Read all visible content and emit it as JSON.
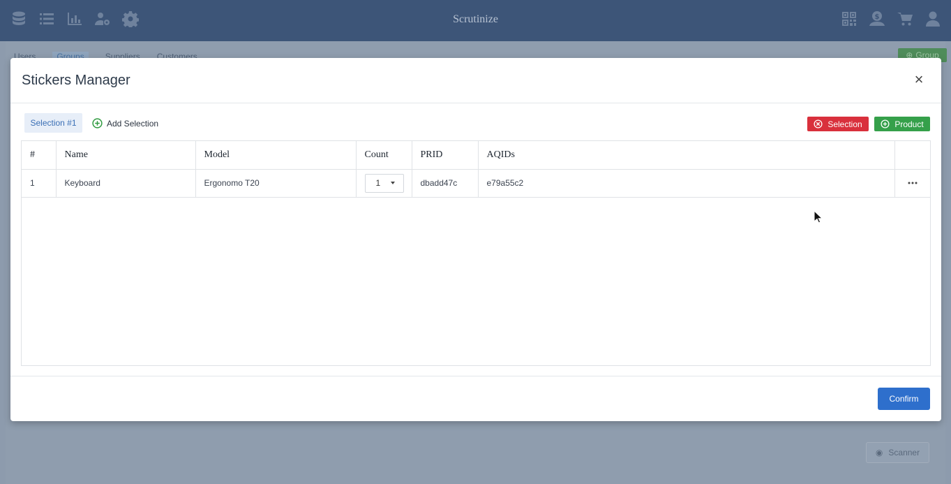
{
  "app": {
    "title": "Scrutinize",
    "nav_icons": [
      "database-icon",
      "list-icon",
      "bar-chart-icon",
      "user-settings-icon",
      "gear-icon"
    ],
    "right_icons": [
      "qr-code-icon",
      "dollar-person-icon",
      "cart-icon",
      "user-icon"
    ]
  },
  "background": {
    "tabs": [
      "Users",
      "Groups",
      "Suppliers",
      "Customers"
    ],
    "active_tab": "Groups",
    "group_button": "Group",
    "scanner_button": "Scanner"
  },
  "modal": {
    "title": "Stickers Manager",
    "close": "×",
    "selection_tab": "Selection #1",
    "add_selection": "Add Selection",
    "remove_selection_button": "Selection",
    "add_product_button": "Product",
    "table": {
      "headers": [
        "#",
        "Name",
        "Model",
        "Count",
        "PRID",
        "AQIDs",
        ""
      ],
      "rows": [
        {
          "num": "1",
          "name": "Keyboard",
          "model": "Ergonomo T20",
          "count": "1",
          "prid": "dbadd47c",
          "aqids": "e79a55c2"
        }
      ]
    },
    "confirm_button": "Confirm"
  },
  "colors": {
    "topbar": "#3d5578",
    "danger": "#d9303c",
    "success": "#35a04a",
    "primary": "#2e6fcc",
    "tab_active_bg": "#e7eef8"
  }
}
